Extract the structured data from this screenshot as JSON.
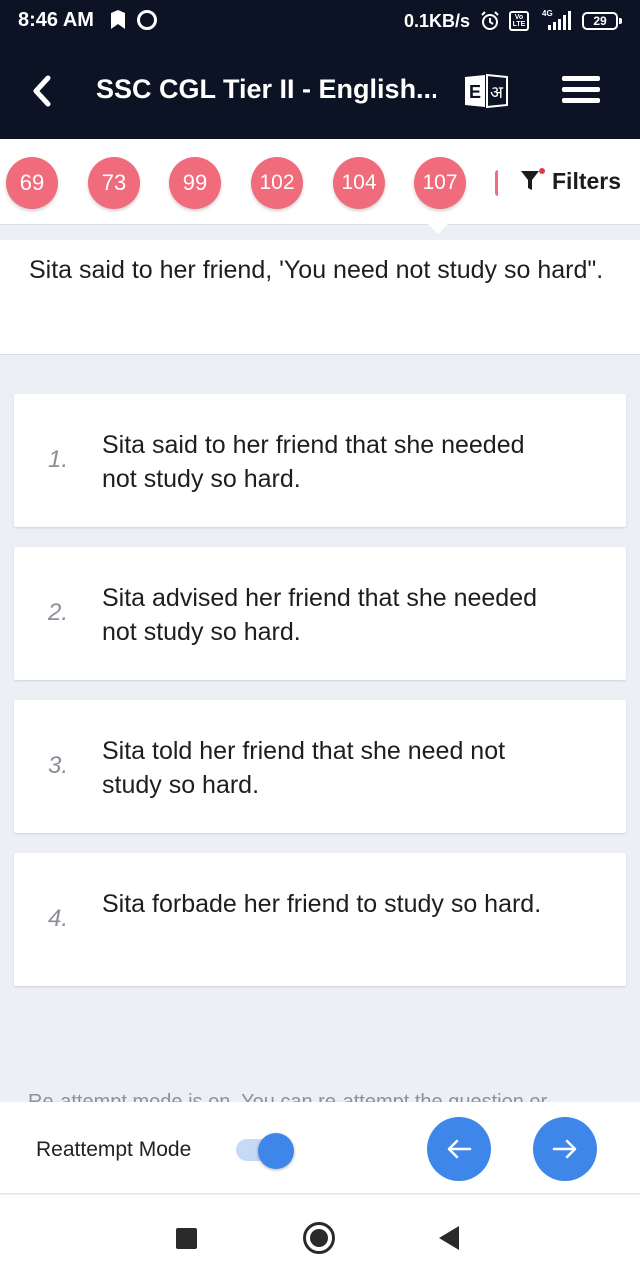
{
  "status_bar": {
    "time": "8:46 AM",
    "network_speed": "0.1KB/s",
    "volte_label": "Vo LTE",
    "network_type": "4G",
    "battery": "29"
  },
  "app_bar": {
    "title": "SSC CGL Tier II - English...",
    "lang_icon_letters": "E अ"
  },
  "question_chips": [
    "69",
    "73",
    "99",
    "102",
    "104",
    "107"
  ],
  "filters_label": "Filters",
  "question": {
    "text": "Sita said to her friend, 'You need not study so hard\"."
  },
  "options": [
    {
      "number": "1.",
      "text": "Sita said to her friend that she needed not study so hard."
    },
    {
      "number": "2.",
      "text": "Sita advised her friend that she needed not study so hard."
    },
    {
      "number": "3.",
      "text": "Sita told her friend that she need not study so hard."
    },
    {
      "number": "4.",
      "text": "Sita forbade her friend to study so hard."
    }
  ],
  "info_line": "Re-attempt mode is on. You can re-attempt the question or",
  "bottom_bar": {
    "reattempt_label": "Reattempt Mode",
    "reattempt_enabled": true
  },
  "colors": {
    "header_bg": "#0b1325",
    "chip_color": "#f06b7c",
    "accent_blue": "#3f86ea",
    "page_bg": "#eceff3"
  }
}
